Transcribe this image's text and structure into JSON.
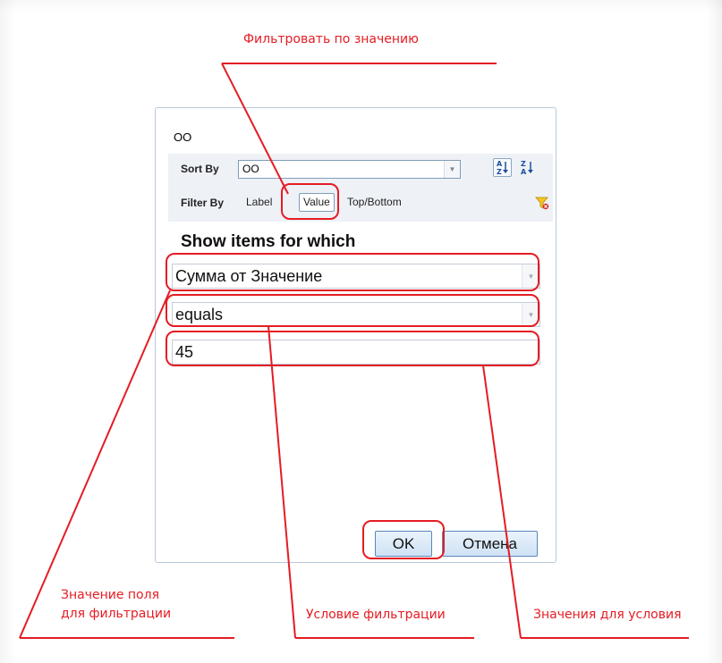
{
  "dialog": {
    "title": "OO",
    "sort": {
      "label": "Sort By",
      "selected": "OO"
    },
    "filter": {
      "label": "Filter By",
      "options": [
        "Label",
        "Value",
        "Top/Bottom"
      ],
      "active": "Value"
    },
    "heading": "Show items for which",
    "field_select": "Сумма от Значение",
    "condition_select": "equals",
    "value_input": "45",
    "ok_label": "OK",
    "cancel_label": "Отмена"
  },
  "annotations": {
    "filter_by_value": "Фильтровать по значению",
    "field_value_line1": "Значение поля",
    "field_value_line2": "для фильтрации",
    "filter_condition": "Условие фильтрации",
    "condition_values": "Значения для условия"
  },
  "colors": {
    "annotation": "#e51c23",
    "button_border": "#5a86bb",
    "toolbar_bg": "#eef1f6"
  }
}
